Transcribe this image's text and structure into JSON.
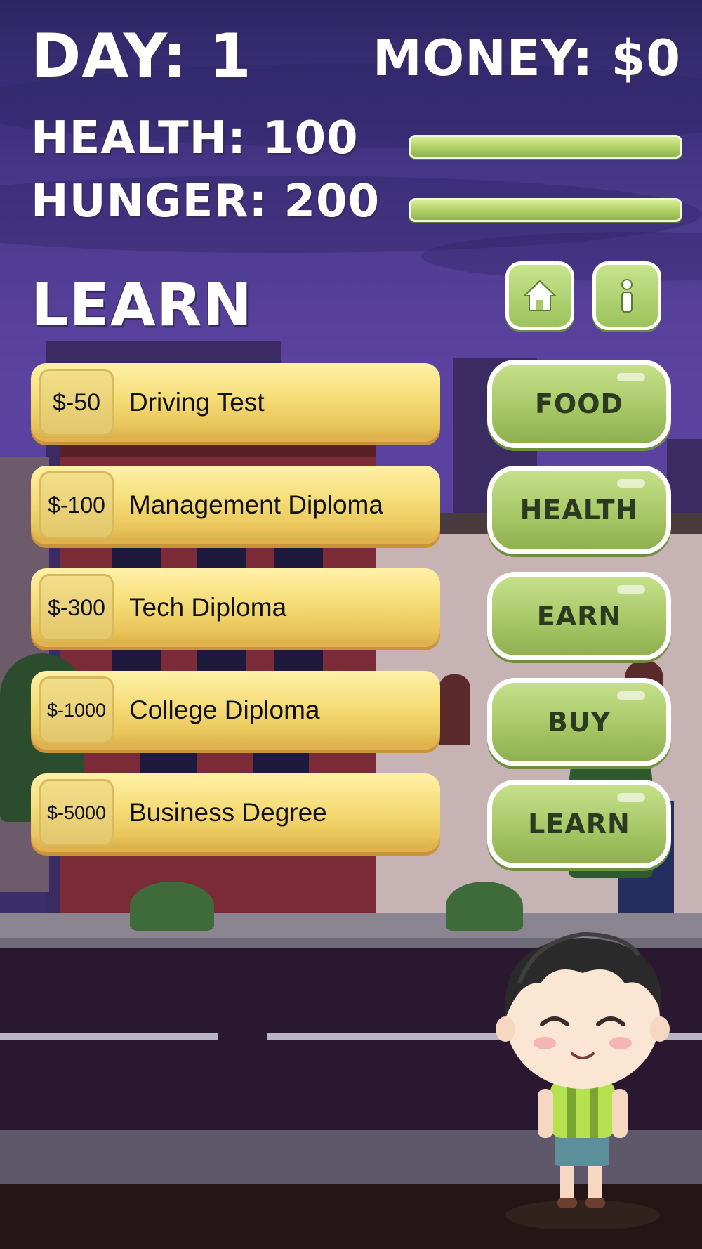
{
  "hud": {
    "day_label": "DAY: 1",
    "money_label": "MONEY: $0",
    "health_label": "HEALTH: 100",
    "hunger_label": "HUNGER: 200",
    "health_bar_level": 1.0,
    "hunger_bar_level": 1.0
  },
  "screen": {
    "title": "LEARN"
  },
  "icons": {
    "home": "home-icon",
    "info": "info-icon"
  },
  "courses": [
    {
      "price": "$-50",
      "name": "Driving Test"
    },
    {
      "price": "$-100",
      "name": "Management Diploma"
    },
    {
      "price": "$-300",
      "name": "Tech Diploma"
    },
    {
      "price": "$-1000",
      "name": "College Diploma"
    },
    {
      "price": "$-5000",
      "name": "Business Degree"
    }
  ],
  "menu": [
    "FOOD",
    "HEALTH",
    "EARN",
    "BUY",
    "LEARN"
  ],
  "colors": {
    "accent_green": "#a8c868",
    "item_yellow": "#f5dc77",
    "sky_purple": "#5b43a0"
  }
}
